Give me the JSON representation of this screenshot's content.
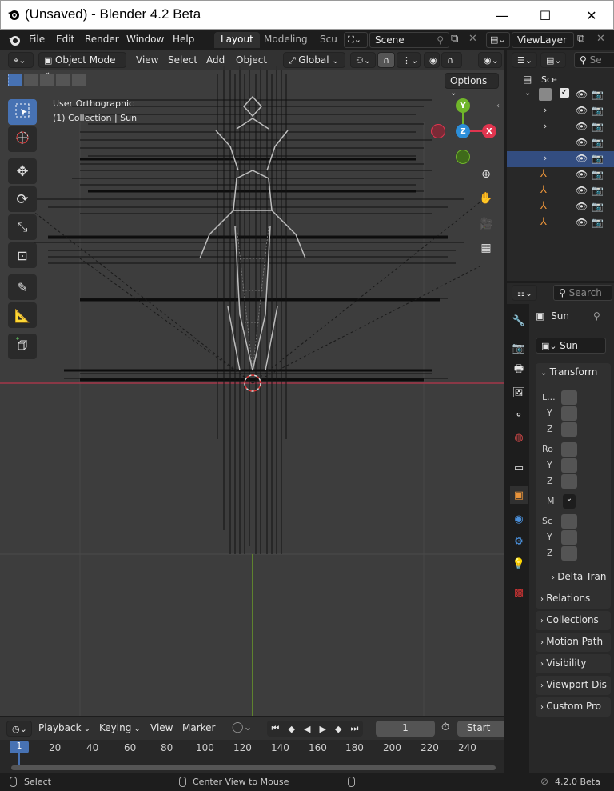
{
  "window": {
    "title": "(Unsaved) - Blender 4.2 Beta",
    "minimize": "—",
    "maximize": "☐",
    "close": "✕"
  },
  "menu": {
    "items": [
      "File",
      "Edit",
      "Render",
      "Window",
      "Help"
    ]
  },
  "workspaces": {
    "tabs": [
      "Layout",
      "Modeling",
      "Scu"
    ],
    "active": "Layout"
  },
  "scene": {
    "name": "Scene",
    "view_layer": "ViewLayer"
  },
  "viewport": {
    "mode": "Object Mode",
    "menus": [
      "View",
      "Select",
      "Add",
      "Object"
    ],
    "transform_orientation": "Global",
    "options_label": "Options",
    "overlay_line1": "User Orthographic",
    "overlay_line2": "(1) Collection | Sun",
    "gizmo": {
      "x": "X",
      "y": "Y",
      "z": "Z"
    }
  },
  "outliner": {
    "search_placeholder": "Se",
    "root": "Sce"
  },
  "properties": {
    "search_placeholder": "Search",
    "object_name": "Sun",
    "data_name": "Sun",
    "transform_label": "Transform",
    "location_label": "L...",
    "rotation_label": "Ro",
    "mode_label": "M",
    "scale_label": "Sc",
    "axis_y": "Y",
    "axis_z": "Z",
    "delta_label": "Delta Tran",
    "panels": [
      "Relations",
      "Collections",
      "Motion Path",
      "Visibility",
      "Viewport Dis",
      "Custom Pro"
    ]
  },
  "timeline": {
    "menus": [
      "Playback",
      "Keying",
      "View",
      "Marker"
    ],
    "current_frame": "1",
    "start_label": "Start",
    "current_marker": "1",
    "ticks": [
      "20",
      "40",
      "60",
      "80",
      "100",
      "120",
      "140",
      "160",
      "180",
      "200",
      "220",
      "240"
    ]
  },
  "status": {
    "select": "Select",
    "center_view": "Center View to Mouse",
    "version": "4.2.0 Beta"
  },
  "colors": {
    "accent": "#4772b3",
    "x_axis": "#e0354f",
    "y_axis": "#70b62a",
    "z_axis": "#2c8fd9",
    "object_orange": "#e8933a"
  }
}
